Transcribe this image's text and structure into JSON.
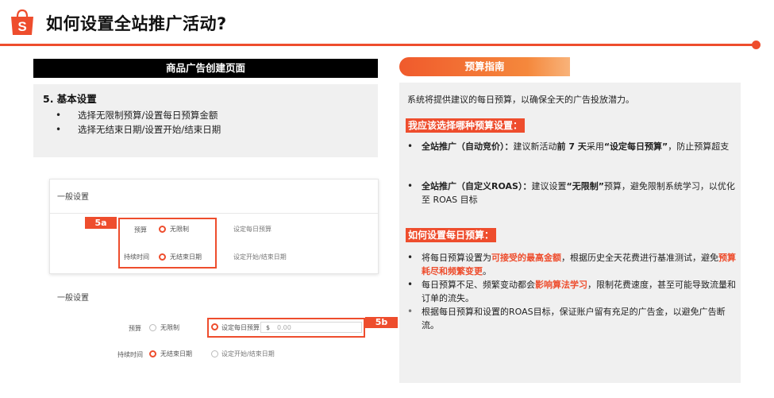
{
  "header": {
    "title": "如何设置全站推广活动?",
    "logo_letter": "S",
    "brand_color": "#ee4d2d"
  },
  "left": {
    "header": "商品广告创建页面",
    "step_title": "5. 基本设置",
    "bullets": [
      "选择无限制预算/设置每日预算金额",
      "选择无结束日期/设置开始/结束日期"
    ]
  },
  "shot1": {
    "section_title": "一般设置",
    "tag": "5a",
    "budget_label": "预算",
    "budget_option_selected": "无限制",
    "budget_option_other": "设定每日预算",
    "duration_label": "持续时间",
    "duration_option_selected": "无结束日期",
    "duration_option_other": "设定开始/结束日期"
  },
  "shot2": {
    "section_title": "一般设置",
    "tag": "5b",
    "budget_label": "预算",
    "budget_option_unselected": "无限制",
    "budget_option_selected": "设定每日预算",
    "currency": "$",
    "amount_placeholder": "0.00",
    "duration_label": "持续时间",
    "duration_option_selected": "无结束日期",
    "duration_option_other": "设定开始/结束日期"
  },
  "right": {
    "header": "预算指南",
    "intro": "系统将提供建议的每日预算，以确保全天的广告投放潜力。",
    "q1": "我应该选择哪种预算设置：",
    "q1_items": [
      {
        "lead": "全站推广（自动竞价）：",
        "text_a": "建议新活动",
        "bold_b": "前 7 天",
        "text_c": "采用",
        "bold_d": "“设定每日预算”",
        "text_e": "，防止预算超支"
      },
      {
        "lead": "全站推广（自定义ROAS）：",
        "text_a": "建议设置",
        "bold_b": "“无限制”",
        "text_c": "预算，避免限制系统学习，以优化至 ROAS 目标"
      }
    ],
    "q2": "如何设置每日预算：",
    "q2_items": [
      {
        "text_a": "将每日预算设置为",
        "hl_b": "可接受的最高金额",
        "text_c": "，根据历史全天花费进行基准测试，避免",
        "hl_d": "预算耗尽和频繁变更",
        "text_e": "。"
      },
      {
        "text_a": "每日预算不足、频繁变动都会",
        "hl_b": "影响算法学习",
        "text_c": "，限制花费速度，甚至可能导致流量和订单的流失。"
      },
      {
        "text_a": "根据每日预算和设置的ROAS目标，保证账户留有充足的广告金，以避免广告断流。"
      }
    ]
  }
}
